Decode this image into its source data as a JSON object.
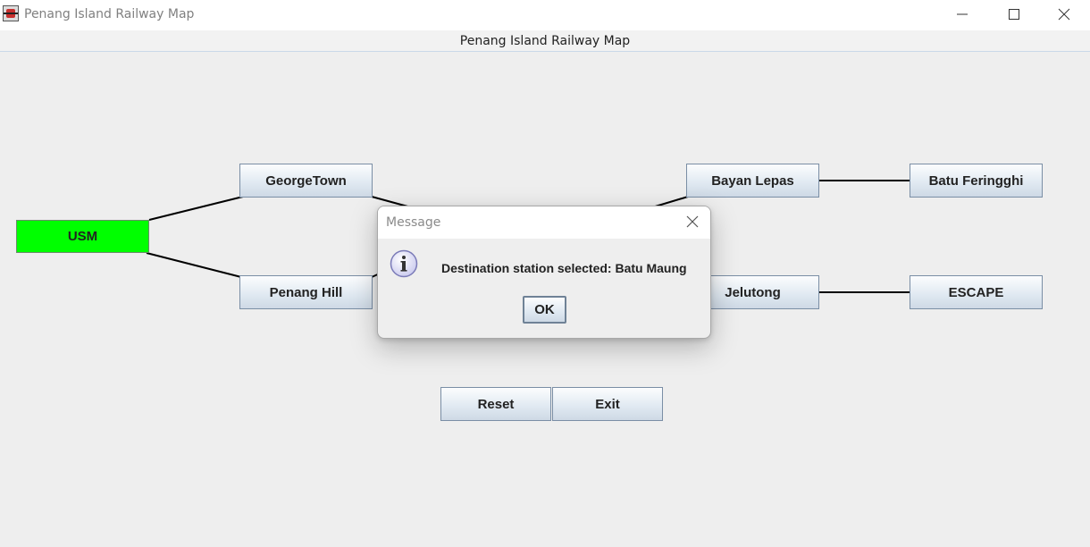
{
  "window": {
    "title": "Penang Island Railway Map"
  },
  "header": {
    "title": "Penang Island Railway Map"
  },
  "stations": {
    "usm": "USM",
    "georgetown": "GeorgeTown",
    "penang_hill": "Penang Hill",
    "bayan_lepas": "Bayan Lepas",
    "batu_feringghi": "Batu Feringghi",
    "jelutong": "Jelutong",
    "escape": "ESCAPE"
  },
  "selected_station": "USM",
  "buttons": {
    "reset": "Reset",
    "exit": "Exit"
  },
  "dialog": {
    "title": "Message",
    "message": "Destination station selected: Batu Maung",
    "ok": "OK",
    "icon": "info-icon"
  },
  "colors": {
    "selected_station": "#00ff00",
    "background": "#eeeeee"
  }
}
